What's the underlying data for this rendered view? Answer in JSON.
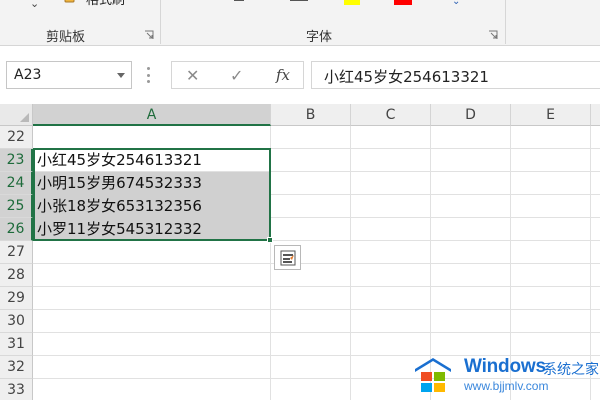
{
  "ribbon": {
    "format_painter_label": "格式刷",
    "groups": [
      {
        "label": "剪贴板"
      },
      {
        "label": "字体"
      }
    ],
    "font_color_swatch": "#ff0000",
    "highlight_color_swatch": "#ffff00"
  },
  "formula_bar": {
    "name_box": "A23",
    "cancel_glyph": "✕",
    "enter_glyph": "✓",
    "fx_glyph": "fx",
    "content": "小红45岁女254613321"
  },
  "grid": {
    "columns": [
      "A",
      "B",
      "C",
      "D",
      "E"
    ],
    "rows": [
      "22",
      "23",
      "24",
      "25",
      "26",
      "27",
      "28",
      "29",
      "30",
      "31",
      "32",
      "33"
    ],
    "cells": [
      {
        "row": "23",
        "value": "小红45岁女254613321"
      },
      {
        "row": "24",
        "value": "小明15岁男674532333"
      },
      {
        "row": "25",
        "value": "小张18岁女653132356"
      },
      {
        "row": "26",
        "value": "小罗11岁女545312332"
      }
    ],
    "selection": "A23:A26",
    "accent_color": "#217346"
  },
  "watermark": {
    "brand": "Windows",
    "brand_cn": "系统之家",
    "url": "www.bjjmlv.com"
  }
}
